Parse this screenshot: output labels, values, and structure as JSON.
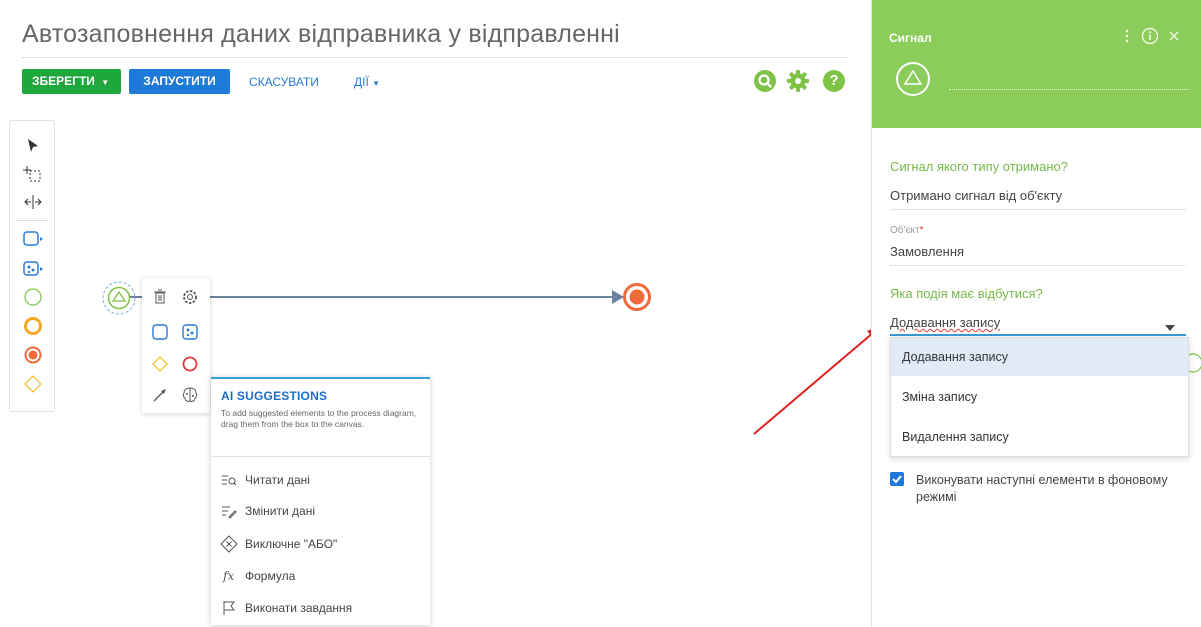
{
  "page": {
    "title": "Автозаповнення даних відправника у відправленні"
  },
  "toolbar": {
    "save_label": "ЗБЕРЕГТИ",
    "run_label": "ЗАПУСТИТИ",
    "cancel_label": "СКАСУВАТИ",
    "actions_label": "ДІЇ",
    "right_icons": [
      "search-icon",
      "gear-icon",
      "help-icon"
    ],
    "help_glyph": "?"
  },
  "colors": {
    "green": "#1ea83c",
    "blue": "#1d7ad8",
    "panel_green": "#8ccc5a",
    "end_event": "#f06a3a"
  },
  "ai_suggestions": {
    "title": "AI SUGGESTIONS",
    "description": "To add suggested elements to the process diagram, drag them from the box to the canvas.",
    "items": [
      {
        "label": "Читати дані",
        "icon": "read-data-icon"
      },
      {
        "label": "Змінити дані",
        "icon": "modify-data-icon"
      },
      {
        "label": "Виключне \"АБО\"",
        "icon": "exclusive-gateway-icon"
      },
      {
        "label": "Формула",
        "icon": "formula-icon"
      },
      {
        "label": "Виконати завдання",
        "icon": "perform-task-icon"
      }
    ],
    "formula_glyph": "fx"
  },
  "side_panel": {
    "title": "Сигнал",
    "question1": "Сигнал якого типу отримано?",
    "answer1": "Отримано сигнал від об'єкту",
    "object_label": "Об'єкт",
    "required_mark": "*",
    "object_value": "Замовлення",
    "question2": "Яка подія має відбутися?",
    "select_value": "Додавання запису",
    "options": [
      "Додавання запису",
      "Зміна запису",
      "Видалення запису"
    ],
    "checkbox_label": "Виконувати наступні елементи в фоновому режимі",
    "checkbox_checked": true
  }
}
